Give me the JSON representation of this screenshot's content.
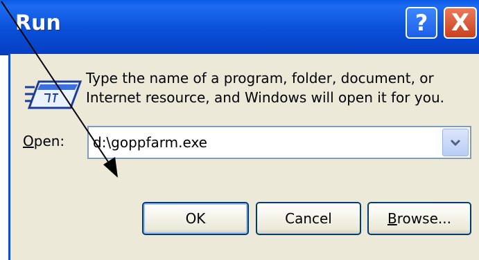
{
  "window": {
    "title": "Run",
    "help_label": "?",
    "close_label": "X"
  },
  "dialog": {
    "message_line1": "Type the name of a program, folder, document, or",
    "message_line2": "Internet resource, and Windows will open it for you.",
    "open_label_accel": "O",
    "open_label_rest": "pen:",
    "open_value": "d:\\goppfarm.exe"
  },
  "buttons": {
    "ok_label": "OK",
    "cancel_label": "Cancel",
    "browse_accel": "B",
    "browse_rest": "rowse..."
  },
  "icons": {
    "run": "run-icon",
    "dropdown": "chevron-down-icon",
    "annotation": "arrow-annotation"
  },
  "colors": {
    "titlebar": "#0a4fd8",
    "panel": "#ece9d8",
    "close_button": "#c8411f"
  }
}
